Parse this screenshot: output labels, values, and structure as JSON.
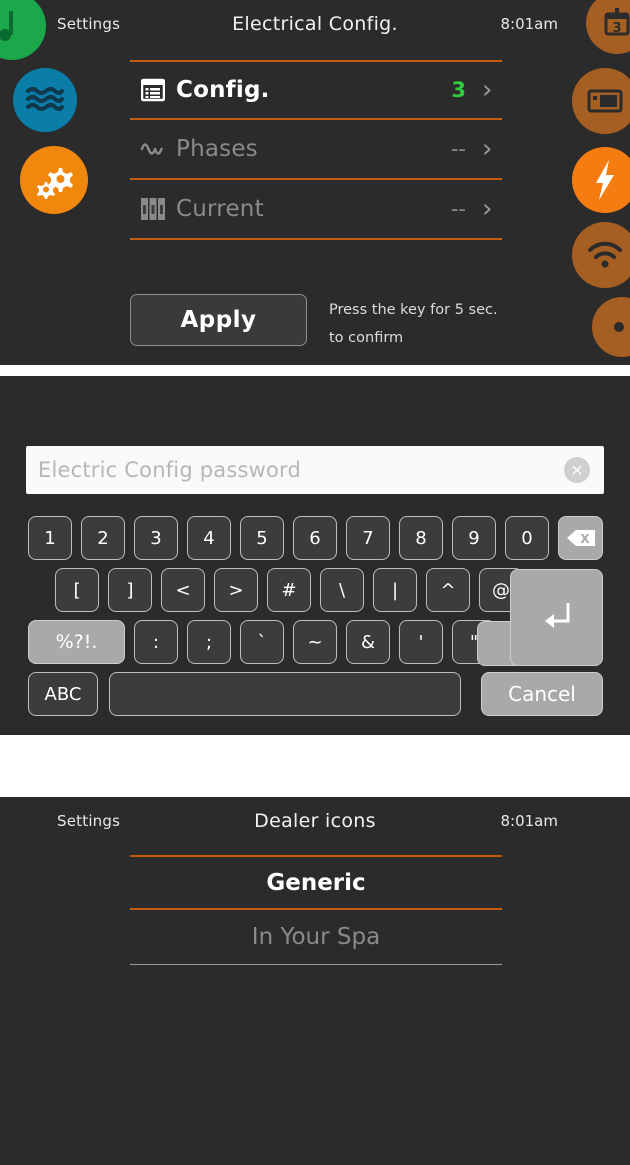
{
  "panels": {
    "electrical": {
      "topbar": {
        "back_label": "Settings",
        "title": "Electrical Config.",
        "time": "8:01am"
      },
      "menu_rows": [
        {
          "icon": "list-config-icon",
          "label": "Config.",
          "value": "3",
          "state": "active"
        },
        {
          "icon": "sine-wave-icon",
          "label": "Phases",
          "value": "--",
          "state": "disabled"
        },
        {
          "icon": "breaker-icon",
          "label": "Current",
          "value": "--",
          "state": "disabled"
        }
      ],
      "chevron": "›",
      "apply_label": "Apply",
      "apply_hint_line1": "Press the key for 5 sec.",
      "apply_hint_line2": "to confirm",
      "left_icons": [
        {
          "name": "music-note-icon",
          "color": "#1aa84a"
        },
        {
          "name": "water-waves-icon",
          "color": "#0a7ea8"
        },
        {
          "name": "gears-icon",
          "color": "#f0880e"
        }
      ],
      "right_icons": [
        {
          "name": "calendar-icon",
          "color": "#a65f23",
          "badge": "3"
        },
        {
          "name": "display-panel-icon",
          "color": "#a65f23"
        },
        {
          "name": "lightning-bolt-icon",
          "color": "#f57c10",
          "selected": true
        },
        {
          "name": "wifi-icon",
          "color": "#a65f23"
        },
        {
          "name": "dot-icon",
          "color": "#a65f23"
        }
      ],
      "accent_color": "#c25a12",
      "value_color": "#2ecc40"
    },
    "keyboard": {
      "password_placeholder": "Electric Config password",
      "password_value": "",
      "clear_glyph": "✕",
      "rows": [
        {
          "keys": [
            {
              "label": "1",
              "name": "key-1"
            },
            {
              "label": "2",
              "name": "key-2"
            },
            {
              "label": "3",
              "name": "key-3"
            },
            {
              "label": "4",
              "name": "key-4"
            },
            {
              "label": "5",
              "name": "key-5"
            },
            {
              "label": "6",
              "name": "key-6"
            },
            {
              "label": "7",
              "name": "key-7"
            },
            {
              "label": "8",
              "name": "key-8"
            },
            {
              "label": "9",
              "name": "key-9"
            },
            {
              "label": "0",
              "name": "key-0"
            },
            {
              "label": "",
              "name": "backspace-key",
              "style": "light",
              "icon": "backspace-icon"
            }
          ]
        },
        {
          "keys": [
            {
              "label": "[",
              "name": "key-bracket-left"
            },
            {
              "label": "]",
              "name": "key-bracket-right"
            },
            {
              "label": "<",
              "name": "key-less-than"
            },
            {
              "label": ">",
              "name": "key-greater-than"
            },
            {
              "label": "#",
              "name": "key-hash"
            },
            {
              "label": "\\",
              "name": "key-backslash"
            },
            {
              "label": "|",
              "name": "key-pipe"
            },
            {
              "label": "^",
              "name": "key-caret"
            },
            {
              "label": "@",
              "name": "key-at"
            }
          ]
        },
        {
          "keys": [
            {
              "label": "%?!.",
              "name": "symbols-toggle-key",
              "style": "light"
            },
            {
              "label": ":",
              "name": "key-colon"
            },
            {
              "label": ";",
              "name": "key-semicolon"
            },
            {
              "label": "`",
              "name": "key-backtick"
            },
            {
              "label": "~",
              "name": "key-tilde"
            },
            {
              "label": "&",
              "name": "key-ampersand"
            },
            {
              "label": "'",
              "name": "key-apostrophe"
            },
            {
              "label": "\"",
              "name": "key-quote"
            }
          ]
        },
        {
          "keys": [
            {
              "label": "ABC",
              "name": "abc-toggle-key"
            },
            {
              "label": "",
              "name": "space-key"
            },
            {
              "label": "Cancel",
              "name": "cancel-key",
              "style": "light"
            }
          ]
        }
      ],
      "enter_name": "enter-key"
    },
    "dealer": {
      "topbar": {
        "back_label": "Settings",
        "title": "Dealer icons",
        "time": "8:01am"
      },
      "options": [
        {
          "label": "Generic",
          "state": "active"
        },
        {
          "label": "In Your Spa",
          "state": "dim"
        }
      ]
    }
  }
}
